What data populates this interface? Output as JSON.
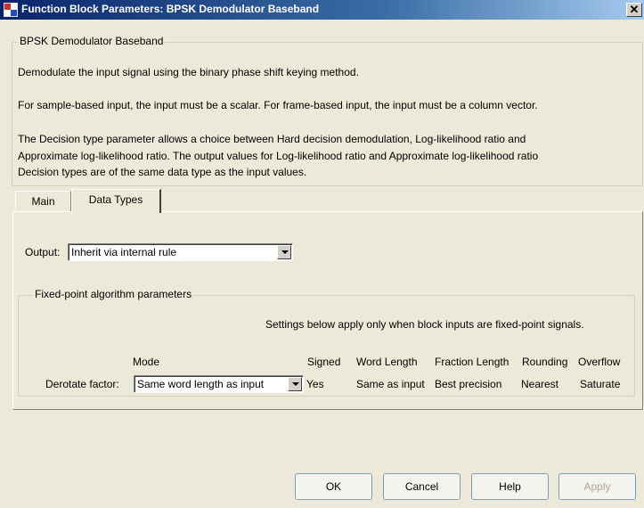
{
  "window": {
    "title": "Function Block Parameters: BPSK Demodulator Baseband",
    "close_glyph": "✕"
  },
  "description_group": {
    "legend": "BPSK Demodulator Baseband",
    "lines": [
      "Demodulate the input signal using the binary phase shift keying method.",
      "For sample-based input, the input must be a scalar. For frame-based input, the input must be a column vector.",
      "The Decision type parameter allows a choice between Hard decision demodulation, Log-likelihood ratio and",
      "Approximate log-likelihood ratio.  The output values for Log-likelihood ratio and Approximate log-likelihood ratio",
      "Decision types are of the same data type as the input values."
    ]
  },
  "tabs": [
    {
      "label": "Main",
      "active": false
    },
    {
      "label": "Data Types",
      "active": true
    }
  ],
  "output": {
    "label": "Output:",
    "value": "Inherit via internal rule"
  },
  "fixed_point": {
    "legend": "Fixed-point algorithm parameters",
    "note": "Settings below apply only when block inputs are fixed-point signals.",
    "headers": {
      "mode": "Mode",
      "signed": "Signed",
      "word_length": "Word Length",
      "fraction_length": "Fraction Length",
      "rounding": "Rounding",
      "overflow": "Overflow"
    },
    "row": {
      "label": "Derotate factor:",
      "mode": "Same word length as input",
      "signed": "Yes",
      "word_length": "Same as input",
      "fraction_length": "Best precision",
      "rounding": "Nearest",
      "overflow": "Saturate"
    }
  },
  "buttons": {
    "ok": "OK",
    "cancel": "Cancel",
    "help": "Help",
    "apply": "Apply"
  }
}
